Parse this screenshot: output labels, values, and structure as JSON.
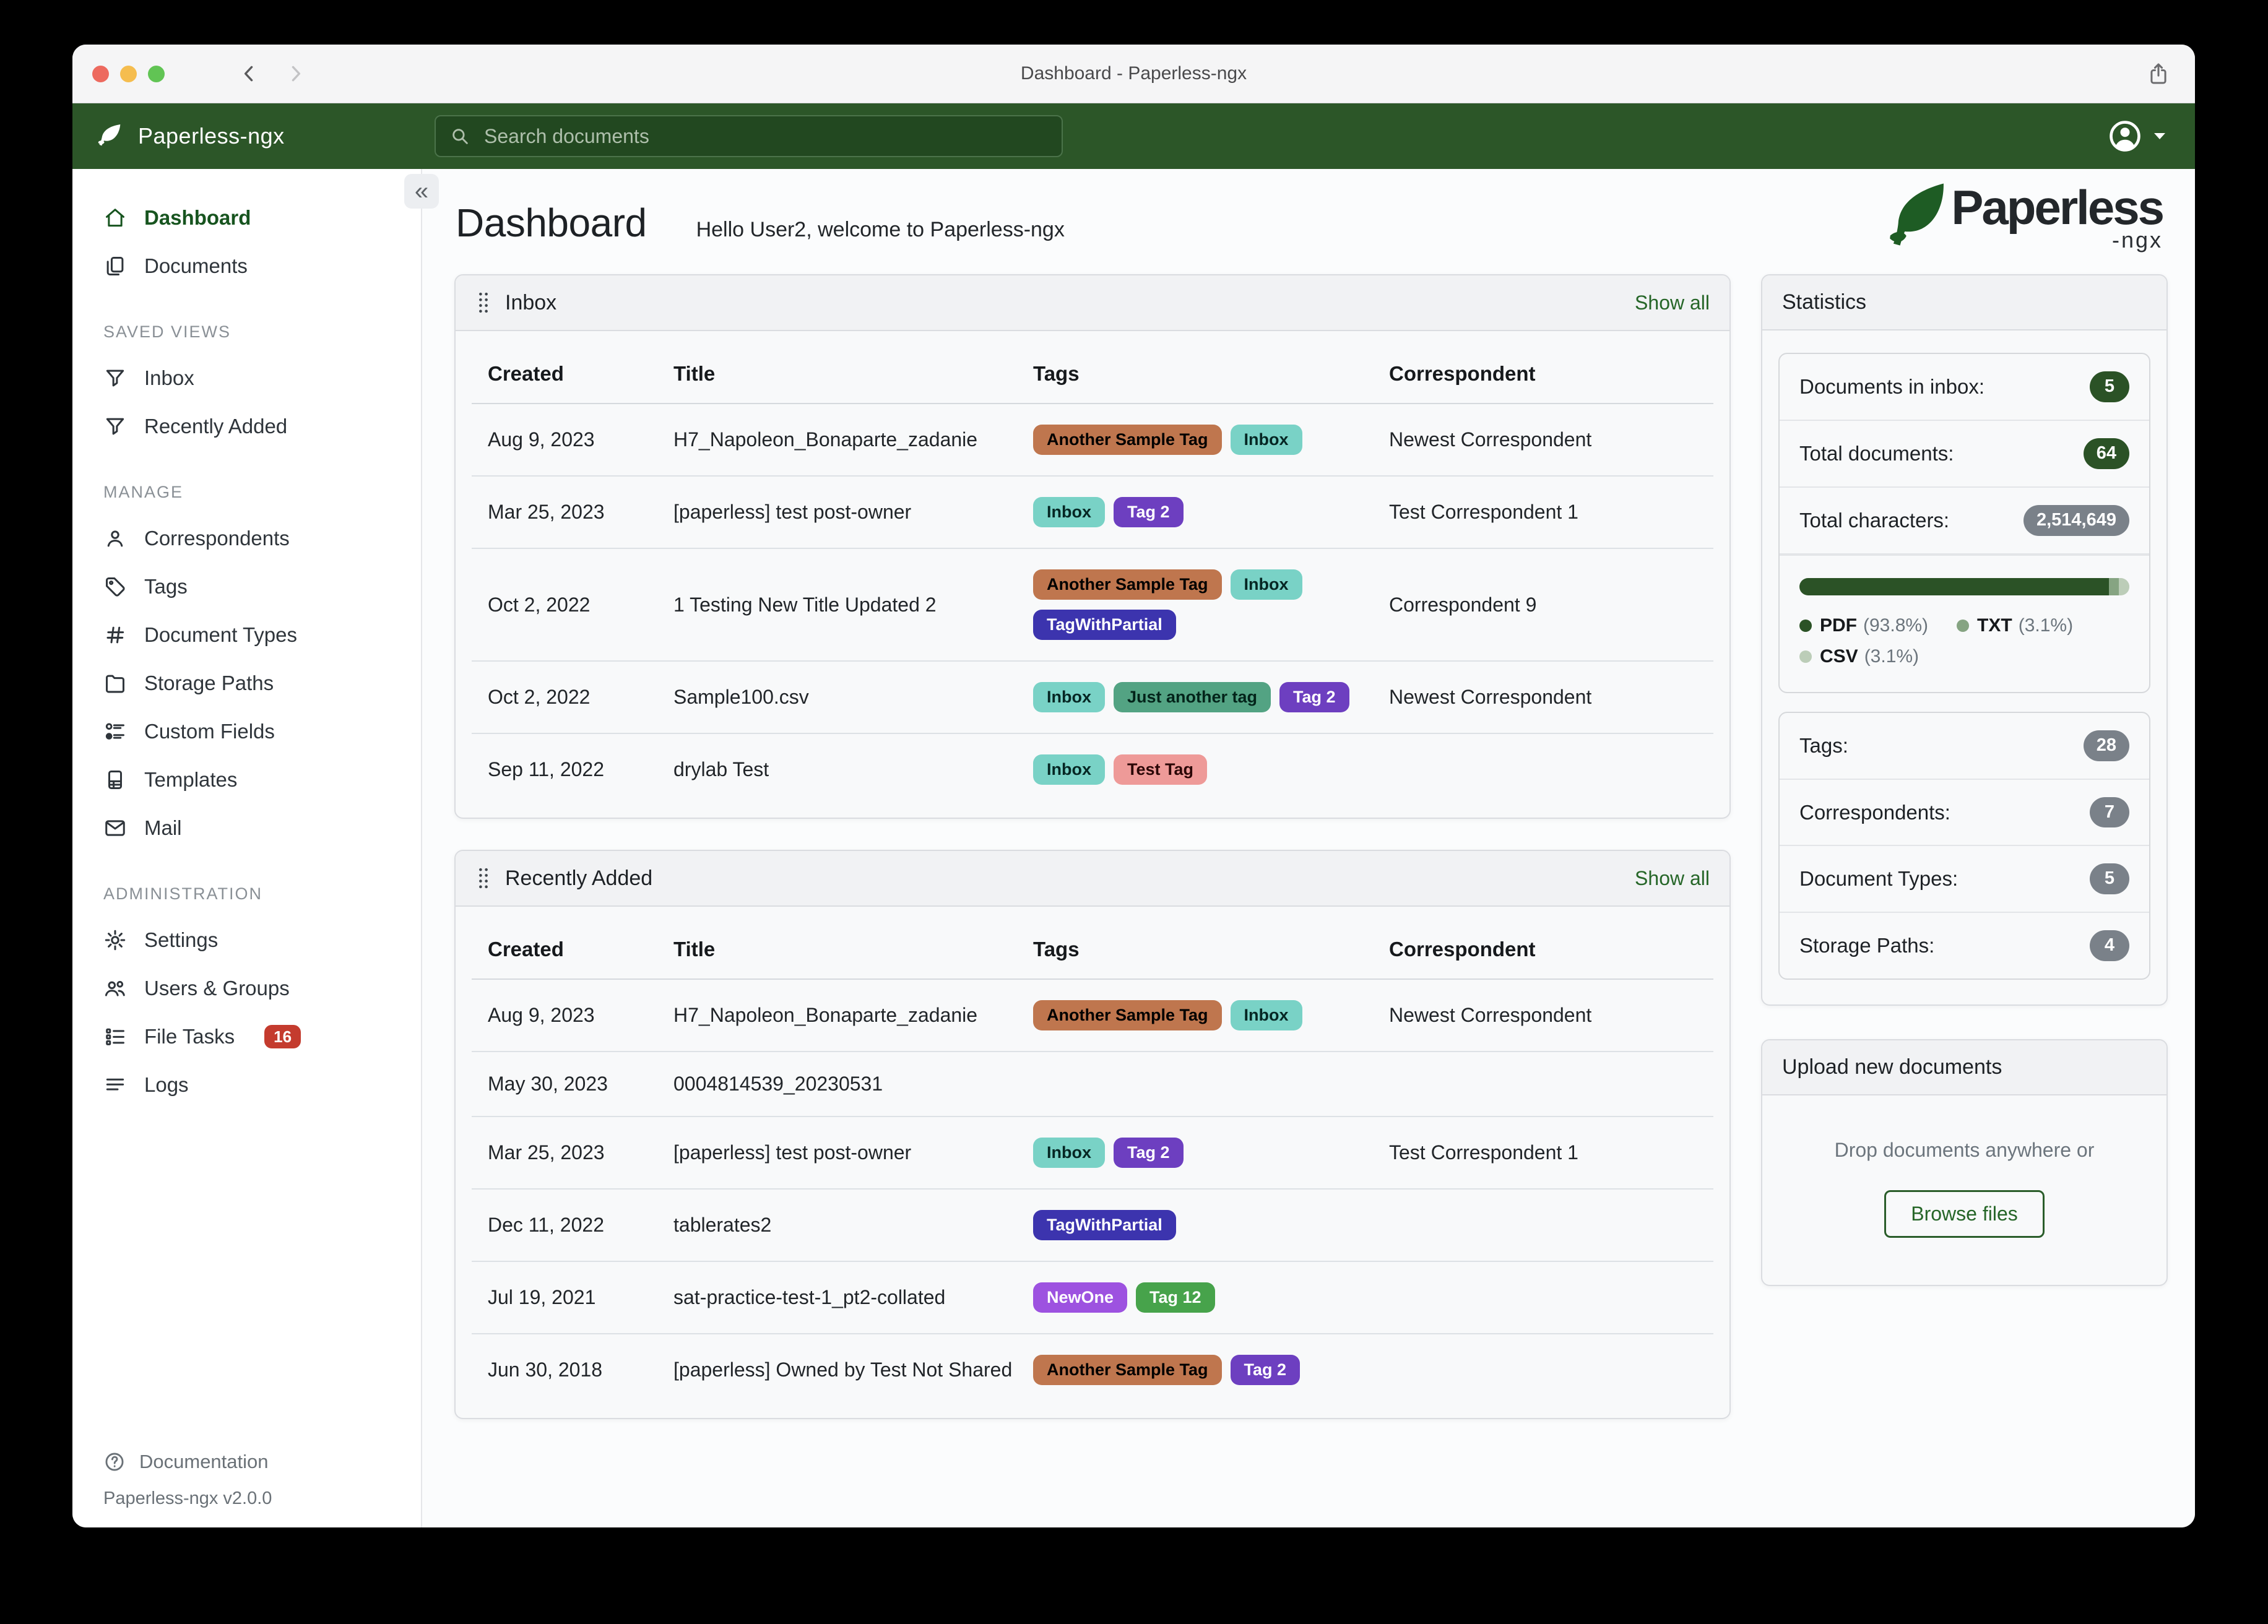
{
  "window": {
    "title": "Dashboard - Paperless-ngx"
  },
  "navbar": {
    "brand": "Paperless-ngx",
    "search_placeholder": "Search documents"
  },
  "sidebar": {
    "primary": [
      {
        "label": "Dashboard",
        "icon": "house-icon",
        "active": true
      },
      {
        "label": "Documents",
        "icon": "documents-icon",
        "active": false
      }
    ],
    "sections": [
      {
        "header": "SAVED VIEWS",
        "items": [
          {
            "label": "Inbox",
            "icon": "funnel-icon"
          },
          {
            "label": "Recently Added",
            "icon": "funnel-icon"
          }
        ]
      },
      {
        "header": "MANAGE",
        "items": [
          {
            "label": "Correspondents",
            "icon": "person-icon"
          },
          {
            "label": "Tags",
            "icon": "tag-icon"
          },
          {
            "label": "Document Types",
            "icon": "hash-icon"
          },
          {
            "label": "Storage Paths",
            "icon": "folder-icon"
          },
          {
            "label": "Custom Fields",
            "icon": "checklist-icon"
          },
          {
            "label": "Templates",
            "icon": "file-lines-icon"
          },
          {
            "label": "Mail",
            "icon": "envelope-icon"
          }
        ]
      },
      {
        "header": "ADMINISTRATION",
        "items": [
          {
            "label": "Settings",
            "icon": "gear-icon"
          },
          {
            "label": "Users & Groups",
            "icon": "users-icon"
          },
          {
            "label": "File Tasks",
            "icon": "list-check-icon",
            "badge": "16"
          },
          {
            "label": "Logs",
            "icon": "text-lines-icon"
          }
        ]
      }
    ],
    "documentation_label": "Documentation",
    "version": "Paperless-ngx v2.0.0"
  },
  "main": {
    "heading": "Dashboard",
    "greeting": "Hello User2, welcome to Paperless-ngx",
    "columns": [
      "Created",
      "Title",
      "Tags",
      "Correspondent"
    ],
    "panels": [
      {
        "title": "Inbox",
        "show_all": "Show all",
        "rows": [
          {
            "created": "Aug 9, 2023",
            "title": "H7_Napoleon_Bonaparte_zadanie",
            "tags": [
              "Another Sample Tag",
              "Inbox"
            ],
            "correspondent": "Newest Correspondent"
          },
          {
            "created": "Mar 25, 2023",
            "title": "[paperless] test post-owner",
            "tags": [
              "Inbox",
              "Tag 2"
            ],
            "correspondent": "Test Correspondent 1"
          },
          {
            "created": "Oct 2, 2022",
            "title": "1 Testing New Title Updated 2",
            "tags": [
              "Another Sample Tag",
              "Inbox",
              "TagWithPartial"
            ],
            "correspondent": "Correspondent 9"
          },
          {
            "created": "Oct 2, 2022",
            "title": "Sample100.csv",
            "tags": [
              "Inbox",
              "Just another tag",
              "Tag 2"
            ],
            "correspondent": "Newest Correspondent"
          },
          {
            "created": "Sep 11, 2022",
            "title": "drylab Test",
            "tags": [
              "Inbox",
              "Test Tag"
            ],
            "correspondent": ""
          }
        ]
      },
      {
        "title": "Recently Added",
        "show_all": "Show all",
        "rows": [
          {
            "created": "Aug 9, 2023",
            "title": "H7_Napoleon_Bonaparte_zadanie",
            "tags": [
              "Another Sample Tag",
              "Inbox"
            ],
            "correspondent": "Newest Correspondent"
          },
          {
            "created": "May 30, 2023",
            "title": "0004814539_20230531",
            "tags": [],
            "correspondent": ""
          },
          {
            "created": "Mar 25, 2023",
            "title": "[paperless] test post-owner",
            "tags": [
              "Inbox",
              "Tag 2"
            ],
            "correspondent": "Test Correspondent 1"
          },
          {
            "created": "Dec 11, 2022",
            "title": "tablerates2",
            "tags": [
              "TagWithPartial"
            ],
            "correspondent": ""
          },
          {
            "created": "Jul 19, 2021",
            "title": "sat-practice-test-1_pt2-collated",
            "tags": [
              "NewOne",
              "Tag 12"
            ],
            "correspondent": ""
          },
          {
            "created": "Jun 30, 2018",
            "title": "[paperless] Owned by Test Not Shared",
            "tags": [
              "Another Sample Tag",
              "Tag 2"
            ],
            "correspondent": ""
          }
        ]
      }
    ]
  },
  "tag_styles": {
    "Another Sample Tag": {
      "bg": "#bf764e",
      "fg": "#000000"
    },
    "Inbox": {
      "bg": "#79d2c6",
      "fg": "#062724"
    },
    "Tag 2": {
      "bg": "#6d3fc0",
      "fg": "#ffffff"
    },
    "TagWithPartial": {
      "bg": "#3c34ae",
      "fg": "#ffffff"
    },
    "Just another tag": {
      "bg": "#53a383",
      "fg": "#03241a"
    },
    "Test Tag": {
      "bg": "#ee9a98",
      "fg": "#2b0606"
    },
    "NewOne": {
      "bg": "#9d52e0",
      "fg": "#ffffff"
    },
    "Tag 12": {
      "bg": "#47a34b",
      "fg": "#ffffff"
    }
  },
  "stats": {
    "title": "Statistics",
    "items_primary": [
      {
        "label": "Documents in inbox:",
        "value": "5",
        "style": "green"
      },
      {
        "label": "Total documents:",
        "value": "64",
        "style": "green"
      },
      {
        "label": "Total characters:",
        "value": "2,514,649",
        "style": "gray"
      }
    ],
    "file_type_chart": {
      "type": "bar",
      "segments": [
        {
          "label": "PDF",
          "pct_text": "(93.8%)",
          "value": 93.8,
          "color": "#2b5226"
        },
        {
          "label": "TXT",
          "pct_text": "(3.1%)",
          "value": 3.1,
          "color": "#86a482"
        },
        {
          "label": "CSV",
          "pct_text": "(3.1%)",
          "value": 3.1,
          "color": "#bccdb8"
        }
      ]
    },
    "items_secondary": [
      {
        "label": "Tags:",
        "value": "28",
        "style": "gray"
      },
      {
        "label": "Correspondents:",
        "value": "7",
        "style": "gray"
      },
      {
        "label": "Document Types:",
        "value": "5",
        "style": "gray"
      },
      {
        "label": "Storage Paths:",
        "value": "4",
        "style": "gray"
      }
    ]
  },
  "upload": {
    "title": "Upload new documents",
    "drop_text": "Drop documents anywhere or",
    "browse_label": "Browse files"
  },
  "logo": {
    "word": "Paperless",
    "suffix": "-ngx"
  },
  "colors": {
    "navbar_green": "#2c5628",
    "accent_green": "#17541f",
    "link_green": "#266628",
    "badge_green": "#2b5226",
    "badge_gray": "#7a8189",
    "danger_badge": "#c43b2e"
  }
}
